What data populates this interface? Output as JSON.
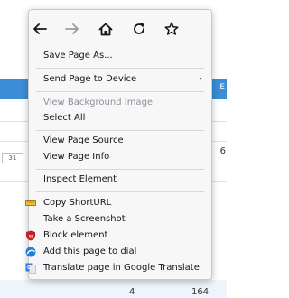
{
  "background": {
    "header_fragment": "E",
    "badge_text": "31",
    "right_value": "6",
    "footer_values": [
      "4",
      "164"
    ]
  },
  "context_menu": {
    "nav": {
      "back_icon": "back-arrow-icon",
      "forward_icon": "forward-arrow-icon",
      "home_icon": "home-icon",
      "reload_icon": "reload-icon",
      "bookmark_icon": "star-icon"
    },
    "items": {
      "save_page": "Save Page As...",
      "send_page": "Send Page to Device",
      "view_bg_image": "View Background Image",
      "select_all": "Select All",
      "view_source": "View Page Source",
      "view_info": "View Page Info",
      "inspect": "Inspect Element",
      "copy_shorturl": "Copy ShortURL",
      "screenshot": "Take a Screenshot",
      "block_element": "Block element",
      "add_dial": "Add this page to dial",
      "translate": "Translate page in Google Translate"
    },
    "submenu_arrow": "›",
    "colors": {
      "menu_bg": "#f7f7f8",
      "disabled_text": "#8f8f9d",
      "accent_blue": "#3a8dd6"
    }
  }
}
